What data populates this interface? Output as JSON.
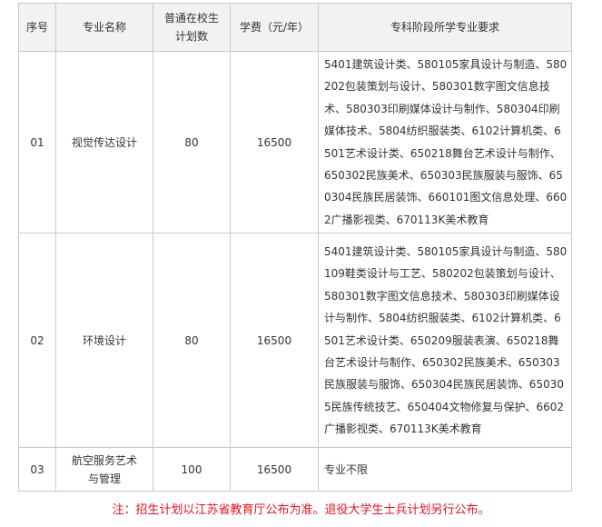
{
  "table": {
    "headers": {
      "index": "序号",
      "major": "专业名称",
      "plan_line1": "普通在校生",
      "plan_line2": "计划数",
      "fee": "学费（元/年）",
      "requirement": "专科阶段所学专业要求"
    },
    "rows": [
      {
        "index": "01",
        "major": "视觉传达设计",
        "plan": "80",
        "fee": "16500",
        "requirement": "5401建筑设计类、580105家具设计与制造、580202包装策划与设计、580301数字图文信息技术、580303印刷媒体设计与制作、580304印刷媒体技术、5804纺织服装类、6102计算机类、6501艺术设计类、650218舞台艺术设计与制作、650302民族美术、650303民族服装与服饰、650304民族民居装饰、660101图文信息处理、6602广播影视类、670113K美术教育"
      },
      {
        "index": "02",
        "major": "环境设计",
        "plan": "80",
        "fee": "16500",
        "requirement": "5401建筑设计类、580105家具设计与制造、580109鞋类设计与工艺、580202包装策划与设计、580301数字图文信息技术、580303印刷媒体设计与制作、5804纺织服装类、6102计算机类、6501艺术设计类、650209服装表演、650218舞台艺术设计与制作、650302民族美术、650303民族服装与服饰、650304民族民居装饰、650305民族传统技艺、650404文物修复与保护、6602广播影视类、670113K美术教育"
      },
      {
        "index": "03",
        "major": "航空服务艺术与管理",
        "plan": "100",
        "fee": "16500",
        "requirement": "专业不限"
      }
    ]
  },
  "note": "注：招生计划以江苏省教育厅公布为准。退役大学生士兵计划另行公布。",
  "colors": {
    "note": "#e8111c",
    "header_bg": "#f2f2f2",
    "border": "#c8c8c8",
    "text": "#333333"
  }
}
